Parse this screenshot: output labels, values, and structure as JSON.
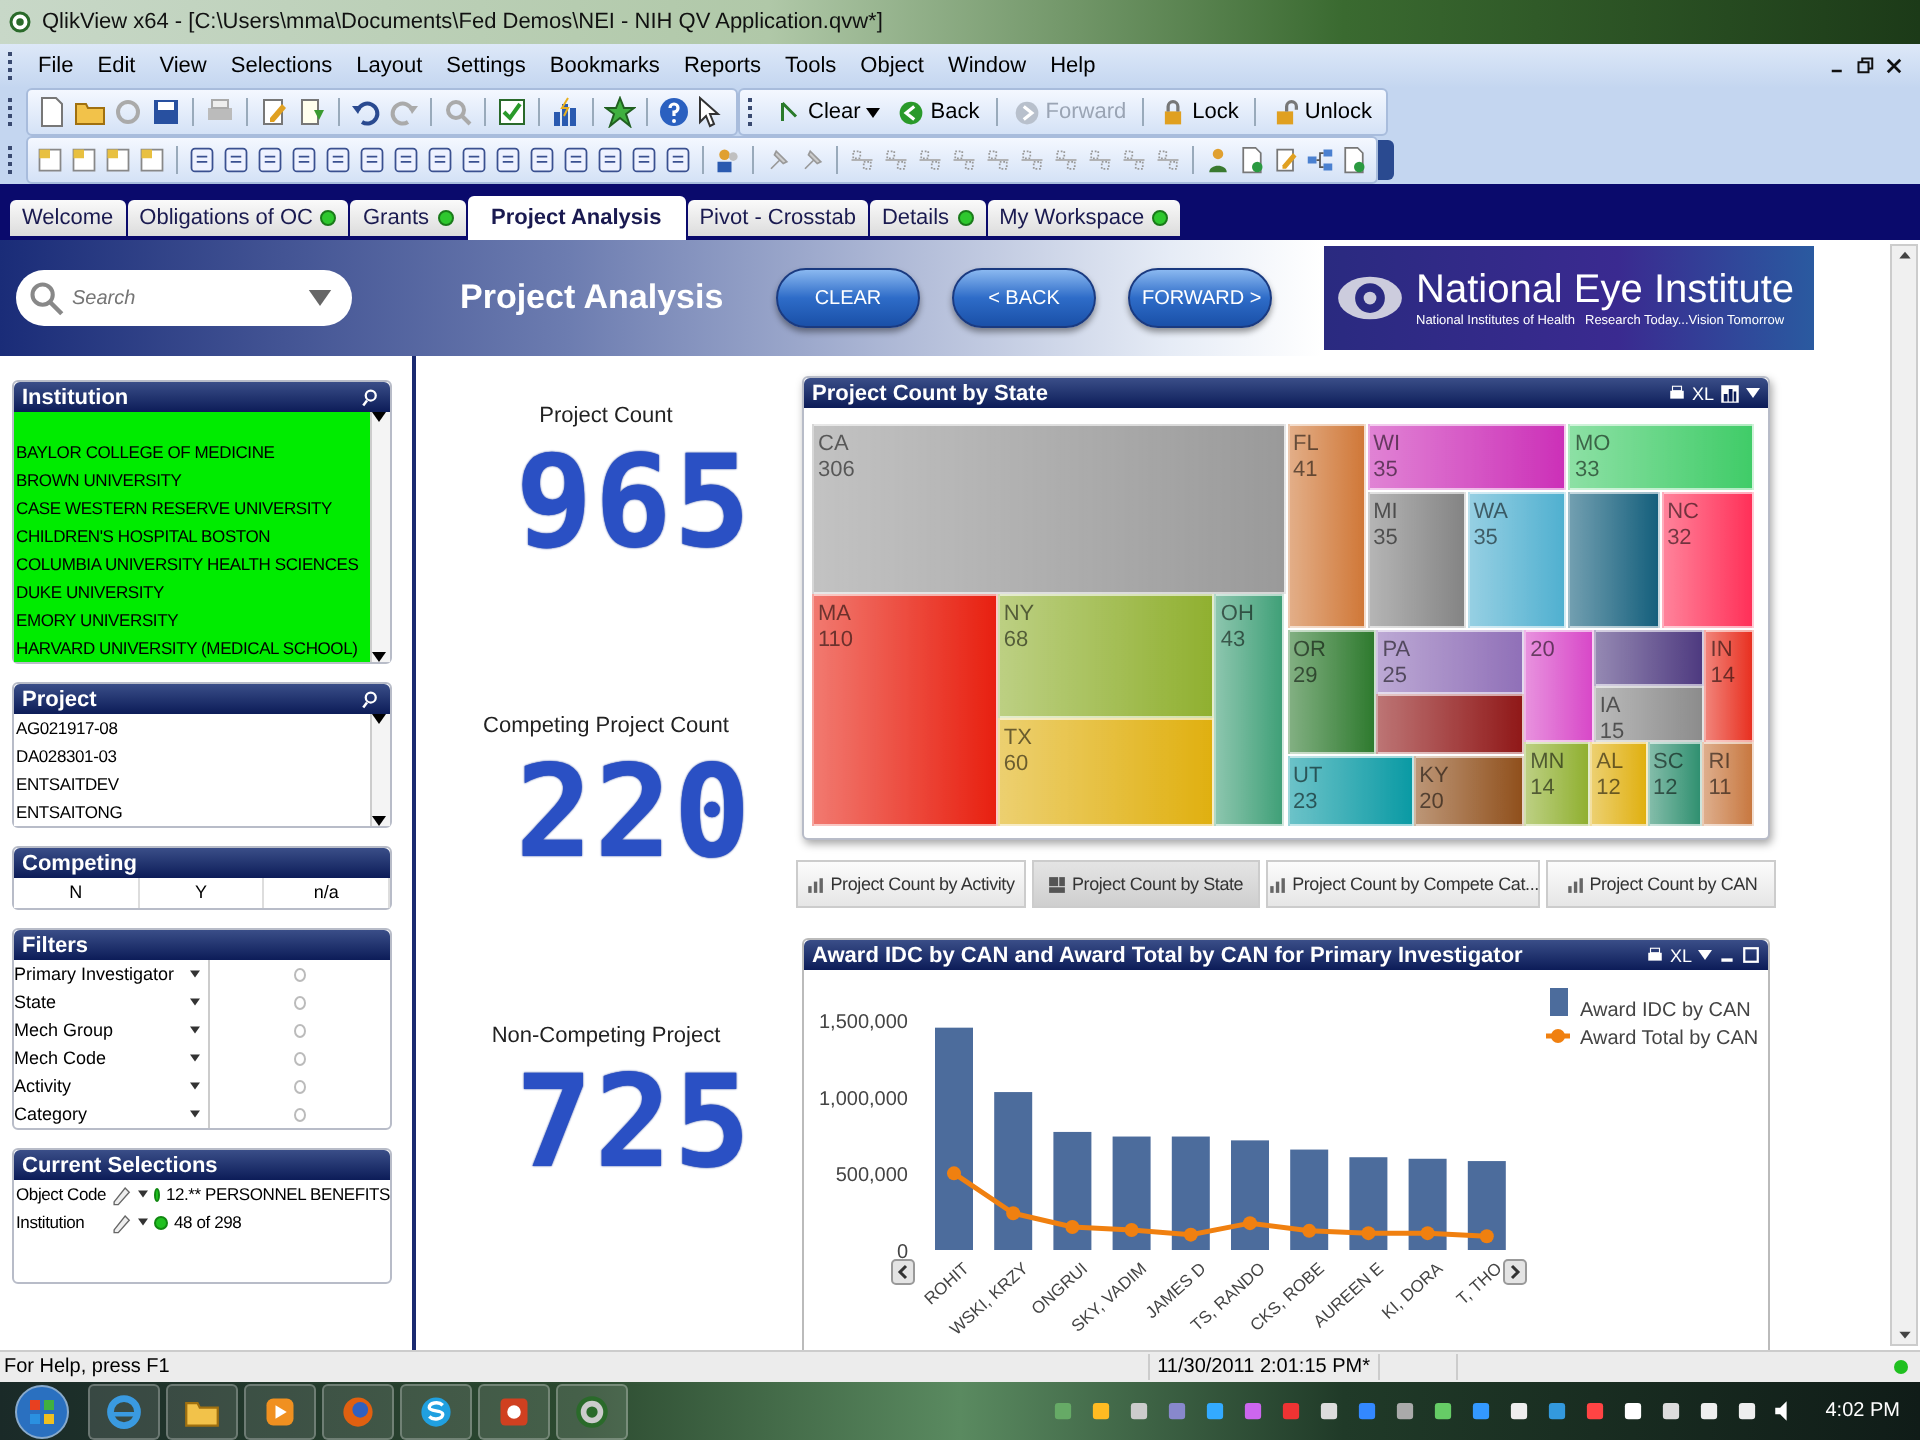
{
  "window": {
    "title": "QlikView x64 - [C:\\Users\\mma\\Documents\\Fed Demos\\NEI - NIH QV Application.qvw*]"
  },
  "menu": [
    "File",
    "Edit",
    "View",
    "Selections",
    "Layout",
    "Settings",
    "Bookmarks",
    "Reports",
    "Tools",
    "Object",
    "Window",
    "Help"
  ],
  "toolbar_buttons": [
    {
      "label": "Clear",
      "kind": "dropdown",
      "disabled": false
    },
    {
      "label": "Back",
      "kind": "back",
      "disabled": false
    },
    {
      "label": "Forward",
      "kind": "forward",
      "disabled": true
    },
    {
      "label": "Lock",
      "kind": "lock",
      "disabled": false
    },
    {
      "label": "Unlock",
      "kind": "unlock",
      "disabled": false
    }
  ],
  "tabs": [
    {
      "label": "Welcome",
      "selected": false,
      "indicator": false
    },
    {
      "label": "Obligations of OC",
      "selected": false,
      "indicator": true
    },
    {
      "label": "Grants",
      "selected": false,
      "indicator": true
    },
    {
      "label": "Project Analysis",
      "selected": true,
      "indicator": false
    },
    {
      "label": "Pivot - Crosstab",
      "selected": false,
      "indicator": false
    },
    {
      "label": "Details",
      "selected": false,
      "indicator": true
    },
    {
      "label": "My Workspace",
      "selected": false,
      "indicator": true
    }
  ],
  "header": {
    "search": {
      "placeholder": "Search"
    },
    "title": "Project Analysis",
    "buttons": [
      "CLEAR",
      "< BACK",
      "FORWARD >"
    ],
    "logo": {
      "name": "National Eye Institute",
      "line_1": "National Institutes of Health",
      "line_2": "Research Today...Vision Tomorrow"
    }
  },
  "institution": {
    "title": "Institution",
    "items": [
      {
        "label": "BAYLOR COLLEGE OF MEDICINE",
        "selected": true
      },
      {
        "label": "BROWN UNIVERSITY",
        "selected": true
      },
      {
        "label": "CASE WESTERN RESERVE UNIVERSITY",
        "selected": true
      },
      {
        "label": "CHILDREN'S HOSPITAL BOSTON",
        "selected": true
      },
      {
        "label": "COLUMBIA UNIVERSITY HEALTH SCIENCES",
        "selected": true
      },
      {
        "label": "DUKE UNIVERSITY",
        "selected": true
      },
      {
        "label": "EMORY UNIVERSITY",
        "selected": true
      },
      {
        "label": "HARVARD UNIVERSITY (MEDICAL SCHOOL)",
        "selected": true
      }
    ]
  },
  "project": {
    "title": "Project",
    "items": [
      {
        "label": "AG021917-08",
        "selected": false
      },
      {
        "label": "DA028301-03",
        "selected": false
      },
      {
        "label": "ENTSAITDEV",
        "selected": false
      },
      {
        "label": "ENTSAITONG",
        "selected": false
      }
    ]
  },
  "competing": {
    "title": "Competing",
    "options": [
      {
        "label": "N",
        "selected": false
      },
      {
        "label": "Y",
        "selected": false
      },
      {
        "label": "n/a",
        "selected": false
      }
    ]
  },
  "filters": {
    "title": "Filters",
    "rows": [
      {
        "label": "Primary Investigator",
        "selected": false
      },
      {
        "label": "State",
        "selected": false
      },
      {
        "label": "Mech Group",
        "selected": false
      },
      {
        "label": "Mech Code",
        "selected": false
      },
      {
        "label": "Activity",
        "selected": false
      },
      {
        "label": "Category",
        "selected": false
      }
    ]
  },
  "current_selections": {
    "title": "Current Selections",
    "rows": [
      {
        "field": "Object Code",
        "value": "12.** PERSONNEL BENEFITS"
      },
      {
        "field": "Institution",
        "value": "48 of 298"
      }
    ]
  },
  "counters": [
    {
      "label": "Project Count",
      "value": "965"
    },
    {
      "label": "Competing Project Count",
      "value": "220"
    },
    {
      "label": "Non-Competing Project",
      "value": "725"
    }
  ],
  "treemap": {
    "title": "Project Count by State",
    "xl": "XL",
    "tiles": [
      {
        "state": "CA",
        "count": "306",
        "color": "#9a9a9a"
      },
      {
        "state": "FL",
        "count": "41",
        "color": "#d07838"
      },
      {
        "state": "WI",
        "count": "35",
        "color": "#cc30b8"
      },
      {
        "state": "MO",
        "count": "33",
        "color": "#40cc68"
      },
      {
        "state": "MI",
        "count": "35",
        "color": "#848484"
      },
      {
        "state": "WA",
        "count": "35",
        "color": "#50b0d0"
      },
      {
        "color": "#145f7c"
      },
      {
        "state": "NC",
        "count": "32",
        "color": "#ff3058"
      },
      {
        "state": "MA",
        "count": "110",
        "color": "#e82010"
      },
      {
        "state": "NY",
        "count": "68",
        "color": "#90b030"
      },
      {
        "state": "OH",
        "count": "43",
        "color": "#40a078"
      },
      {
        "state": "TX",
        "count": "60",
        "color": "#e0b010"
      },
      {
        "state": "OR",
        "count": "29",
        "color": "#2e7a2e"
      },
      {
        "state": "PA",
        "count": "25",
        "color": "#9070b8"
      },
      {
        "count": "20",
        "color": "#d848c8"
      },
      {
        "color": "#4e3a80"
      },
      {
        "state": "IN",
        "count": "14",
        "color": "#e83020"
      },
      {
        "state": "IA",
        "count": "15",
        "color": "#8c8c8c"
      },
      {
        "color": "#901818"
      },
      {
        "state": "UT",
        "count": "23",
        "color": "#0a9aa4"
      },
      {
        "state": "KY",
        "count": "20",
        "color": "#90501c"
      },
      {
        "state": "MN",
        "count": "14",
        "color": "#90b030"
      },
      {
        "state": "AL",
        "count": "12",
        "color": "#e0b010"
      },
      {
        "state": "SC",
        "count": "12",
        "color": "#309070"
      },
      {
        "state": "RI",
        "count": "11",
        "color": "#c87840"
      }
    ]
  },
  "chart_tabs": [
    {
      "label": "Project Count by Activity",
      "kind": "bar",
      "selected": false
    },
    {
      "label": "Project Count by State",
      "kind": "treemap",
      "selected": true
    },
    {
      "label": "Project Count by Compete Cat...",
      "kind": "bar",
      "selected": false
    },
    {
      "label": "Project Count by CAN",
      "kind": "bar",
      "selected": false
    }
  ],
  "award_chart": {
    "title": "Award IDC by CAN and Award Total by CAN for Primary Investigator",
    "xl": "XL",
    "chart_data": {
      "type": "bar",
      "categories": [
        "ROHIT",
        "WSKI, KRZY",
        "ONGRUI",
        "SKY, VADIM",
        "JAMES D",
        "TS, RANDO",
        "CKS, ROBE",
        "AUREEN E",
        "KI, DORA",
        "T, THO"
      ],
      "series": [
        {
          "name": "Award IDC by CAN",
          "color": "#4c6c9c",
          "values": [
            1450000,
            1030000,
            770000,
            740000,
            740000,
            715000,
            655000,
            605000,
            595000,
            580000
          ]
        },
        {
          "name": "Award Total by CAN",
          "type": "line",
          "marker": "circle",
          "color": "#f08010",
          "values": [
            500000,
            240000,
            150000,
            130000,
            100000,
            175000,
            125000,
            110000,
            110000,
            90000
          ]
        }
      ],
      "legend": "top right",
      "ylim": [
        0,
        1500000
      ],
      "yticks": [
        {
          "value": 0,
          "label": "0"
        },
        {
          "value": 500000,
          "label": "500,000"
        },
        {
          "value": 1000000,
          "label": "1,000,000"
        },
        {
          "value": 1500000,
          "label": "1,500,000"
        }
      ]
    }
  },
  "status_bar": {
    "help": "For Help, press F1",
    "timestamp": "11/30/2011 2:01:15 PM*"
  },
  "taskbar": {
    "clock": "4:02 PM"
  }
}
